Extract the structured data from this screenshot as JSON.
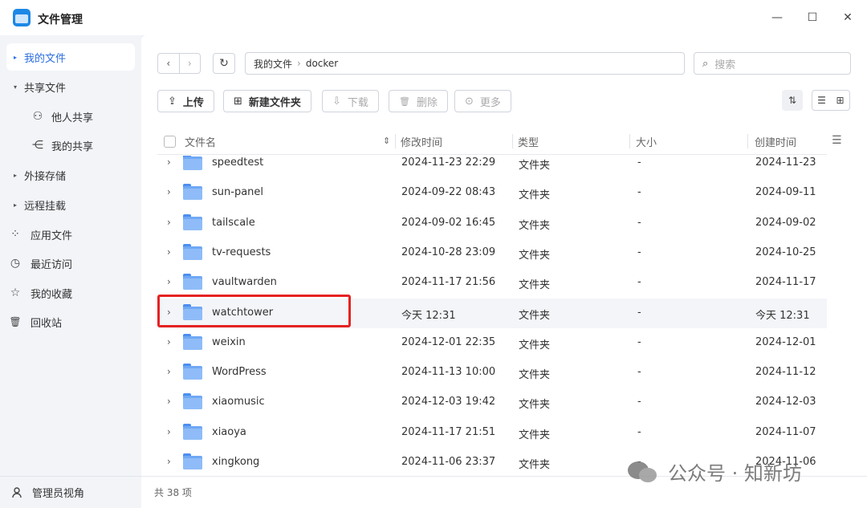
{
  "window": {
    "title": "文件管理",
    "minimize_glyph": "—",
    "maximize_glyph": "☐",
    "close_glyph": "✕"
  },
  "sidebar": {
    "items": [
      {
        "label": "我的文件",
        "icon": "caret-right-icon",
        "glyph": "▸",
        "active": true
      },
      {
        "label": "共享文件",
        "icon": "caret-down-icon",
        "glyph": "▾"
      },
      {
        "label": "他人共享",
        "icon": "users-icon",
        "glyph": "⚇",
        "sub": true
      },
      {
        "label": "我的共享",
        "icon": "share-icon",
        "glyph": "⋲",
        "sub": true
      },
      {
        "label": "外接存储",
        "icon": "caret-right-icon",
        "glyph": "▸"
      },
      {
        "label": "远程挂载",
        "icon": "caret-right-icon",
        "glyph": "▸"
      },
      {
        "label": "应用文件",
        "icon": "apps-icon",
        "glyph": "⁘"
      },
      {
        "label": "最近访问",
        "icon": "clock-icon",
        "glyph": "◷"
      },
      {
        "label": "我的收藏",
        "icon": "star-icon",
        "glyph": "☆"
      },
      {
        "label": "回收站",
        "icon": "trash-icon",
        "glyph": "🗑"
      }
    ],
    "footer_label": "管理员视角",
    "footer_icon": "admin-user-icon"
  },
  "nav": {
    "back_glyph": "‹",
    "forward_glyph": "›",
    "refresh_glyph": "↻",
    "breadcrumb": [
      "我的文件",
      "docker"
    ],
    "breadcrumb_sep": "›",
    "search_placeholder": "搜索",
    "search_glyph": "⌕"
  },
  "toolbar": {
    "upload": "上传",
    "new_folder": "新建文件夹",
    "download": "下载",
    "delete": "删除",
    "more": "更多",
    "upload_glyph": "⇪",
    "new_folder_glyph": "⊞",
    "download_glyph": "⇩",
    "delete_glyph": "🗑",
    "more_glyph": "⊙",
    "sort_glyph": "⇅",
    "list_view_glyph": "☰",
    "grid_view_glyph": "⊞"
  },
  "table": {
    "columns": {
      "name": "文件名",
      "modified": "修改时间",
      "type": "类型",
      "size": "大小",
      "created": "创建时间"
    },
    "sort_glyph": "⇕",
    "settings_glyph": "☰",
    "rows": [
      {
        "name": "speedtest",
        "modified": "2024-11-23 22:29",
        "type": "文件夹",
        "size": "-",
        "created": "2024-11-23"
      },
      {
        "name": "sun-panel",
        "modified": "2024-09-22 08:43",
        "type": "文件夹",
        "size": "-",
        "created": "2024-09-11"
      },
      {
        "name": "tailscale",
        "modified": "2024-09-02 16:45",
        "type": "文件夹",
        "size": "-",
        "created": "2024-09-02"
      },
      {
        "name": "tv-requests",
        "modified": "2024-10-28 23:09",
        "type": "文件夹",
        "size": "-",
        "created": "2024-10-25"
      },
      {
        "name": "vaultwarden",
        "modified": "2024-11-17 21:56",
        "type": "文件夹",
        "size": "-",
        "created": "2024-11-17"
      },
      {
        "name": "watchtower",
        "modified": "今天 12:31",
        "type": "文件夹",
        "size": "-",
        "created": "今天 12:31",
        "highlighted": true
      },
      {
        "name": "weixin",
        "modified": "2024-12-01 22:35",
        "type": "文件夹",
        "size": "-",
        "created": "2024-12-01"
      },
      {
        "name": "WordPress",
        "modified": "2024-11-13 10:00",
        "type": "文件夹",
        "size": "-",
        "created": "2024-11-12"
      },
      {
        "name": "xiaomusic",
        "modified": "2024-12-03 19:42",
        "type": "文件夹",
        "size": "-",
        "created": "2024-12-03"
      },
      {
        "name": "xiaoya",
        "modified": "2024-11-17 21:51",
        "type": "文件夹",
        "size": "-",
        "created": "2024-11-07"
      },
      {
        "name": "xingkong",
        "modified": "2024-11-06 23:37",
        "type": "文件夹",
        "size": "-",
        "created": "2024-11-06"
      }
    ]
  },
  "footer": {
    "count": "共 38 项"
  },
  "watermark": {
    "text": "公众号 · 知新坊"
  },
  "colors": {
    "accent": "#2a6ddf",
    "highlight_border": "#e52222",
    "folder": "#6fa8f5"
  }
}
